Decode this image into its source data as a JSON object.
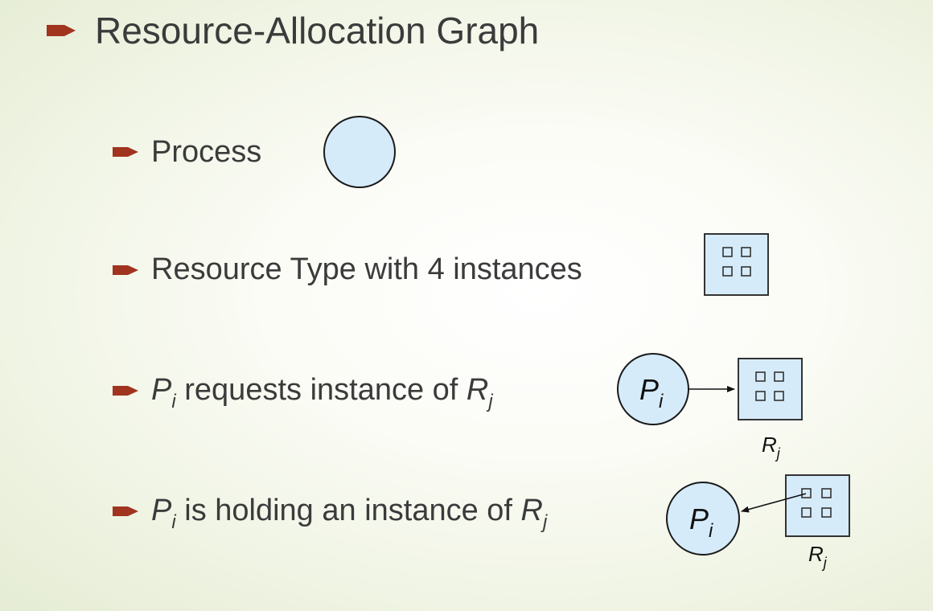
{
  "slide": {
    "title": "Resource-Allocation Graph",
    "bullet_color": "#a0341f",
    "items": [
      {
        "text": "Process"
      },
      {
        "text": "Resource Type with 4 instances"
      },
      {
        "p": "P",
        "p_sub": "i",
        "middle": " requests instance of ",
        "r": "R",
        "r_sub": "j"
      },
      {
        "p": "P",
        "p_sub": "i",
        "middle": " is holding an instance of ",
        "r": "R",
        "r_sub": "j"
      }
    ]
  },
  "diagrams": {
    "fill_color": "#d6ebfa",
    "stroke_color": "#1a1a1a",
    "request": {
      "process_label": "P",
      "process_sub": "i",
      "resource_label": "R",
      "resource_sub": "j"
    },
    "holding": {
      "process_label": "P",
      "process_sub": "i",
      "resource_label": "R",
      "resource_sub": "j"
    }
  }
}
